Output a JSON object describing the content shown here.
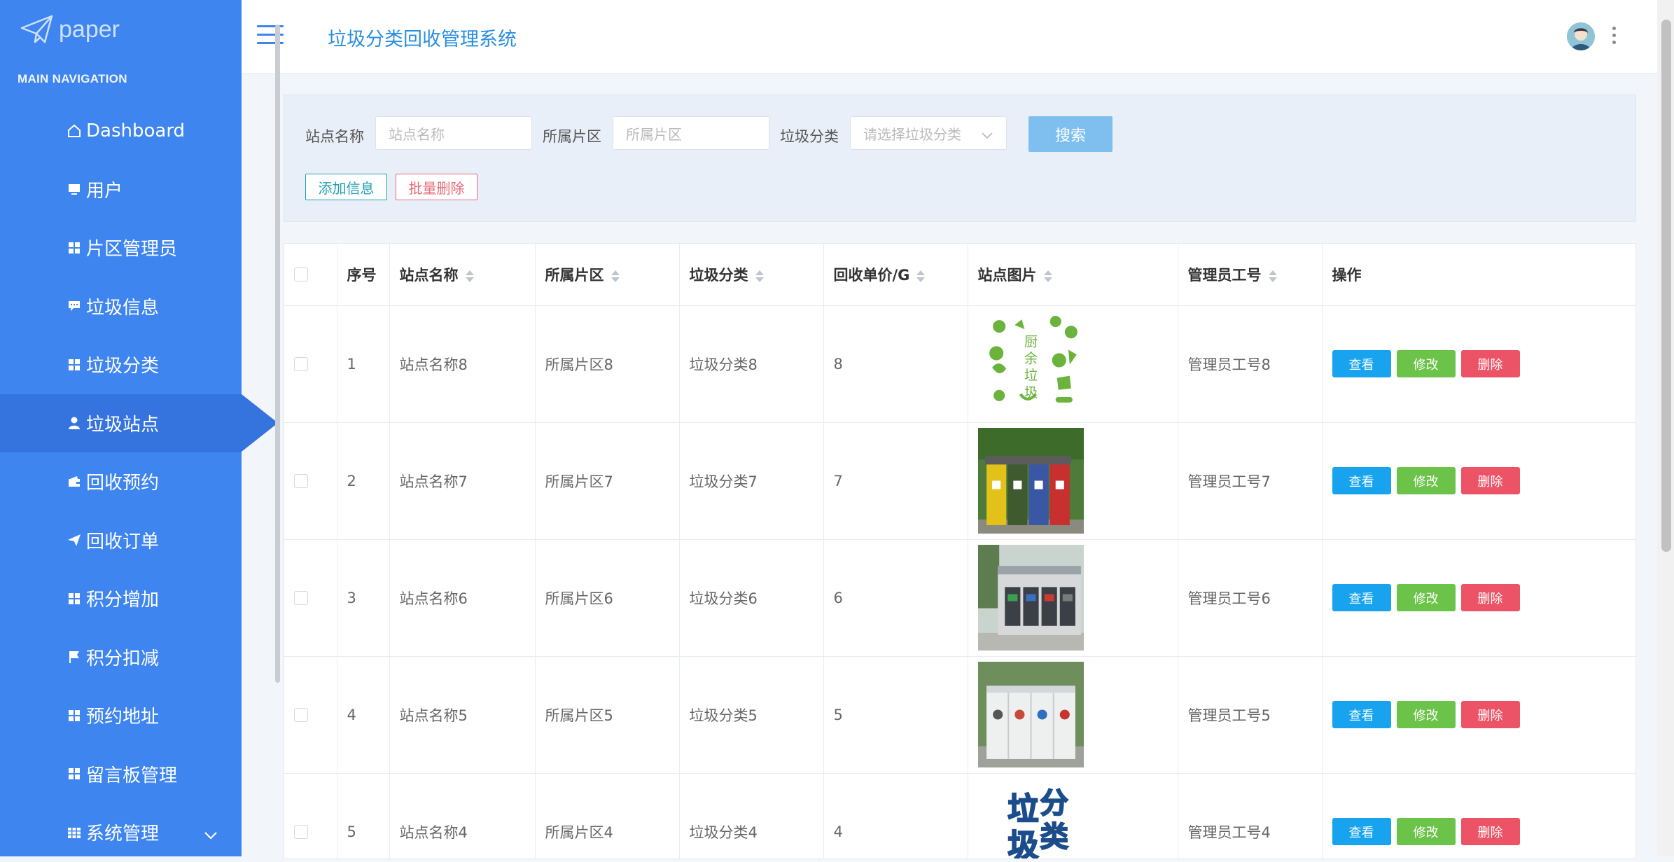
{
  "app": {
    "logo_text": "paper",
    "title": "垃圾分类回收管理系统"
  },
  "sidebar": {
    "section_label": "MAIN NAVIGATION",
    "items": [
      {
        "label": "Dashboard",
        "icon": "home-icon"
      },
      {
        "label": "用户",
        "icon": "monitor-icon"
      },
      {
        "label": "片区管理员",
        "icon": "grid-icon"
      },
      {
        "label": "垃圾信息",
        "icon": "comment-icon"
      },
      {
        "label": "垃圾分类",
        "icon": "grid-icon"
      },
      {
        "label": "垃圾站点",
        "icon": "user-icon",
        "active": true
      },
      {
        "label": "回收预约",
        "icon": "wallet-icon"
      },
      {
        "label": "回收订单",
        "icon": "send-icon"
      },
      {
        "label": "积分增加",
        "icon": "grid-icon"
      },
      {
        "label": "积分扣减",
        "icon": "flag-icon"
      },
      {
        "label": "预约地址",
        "icon": "grid-icon"
      },
      {
        "label": "留言板管理",
        "icon": "grid-icon"
      },
      {
        "label": "系统管理",
        "icon": "table-icon"
      }
    ]
  },
  "filters": {
    "site_name_label": "站点名称",
    "site_name_placeholder": "站点名称",
    "area_label": "所属片区",
    "area_placeholder": "所属片区",
    "category_label": "垃圾分类",
    "category_placeholder": "请选择垃圾分类",
    "search_button": "搜索",
    "add_button": "添加信息",
    "batch_delete_button": "批量删除"
  },
  "table": {
    "headers": [
      "序号",
      "站点名称",
      "所属片区",
      "垃圾分类",
      "回收单价/G",
      "站点图片",
      "管理员工号",
      "操作"
    ],
    "actions": {
      "view": "查看",
      "edit": "修改",
      "delete": "删除"
    },
    "rows": [
      {
        "index": "1",
        "site": "站点名称8",
        "area": "所属片区8",
        "category": "垃圾分类8",
        "price": "8",
        "image": "kitchen-waste-icon",
        "admin": "管理员工号8"
      },
      {
        "index": "2",
        "site": "站点名称7",
        "area": "所属片区7",
        "category": "垃圾分类7",
        "price": "7",
        "image": "colored-bins-photo",
        "admin": "管理员工号7"
      },
      {
        "index": "3",
        "site": "站点名称6",
        "area": "所属片区6",
        "category": "垃圾分类6",
        "price": "6",
        "image": "recycling-station-photo",
        "admin": "管理员工号6"
      },
      {
        "index": "4",
        "site": "站点名称5",
        "area": "所属片区5",
        "category": "垃圾分类5",
        "price": "5",
        "image": "white-bins-photo",
        "admin": "管理员工号5"
      },
      {
        "index": "5",
        "site": "站点名称4",
        "area": "所属片区4",
        "category": "垃圾分类4",
        "price": "4",
        "image": "classification-logo",
        "admin": "管理员工号4"
      }
    ]
  },
  "image_text": {
    "kitchen_waste": "厨余垃圾",
    "classification": "垃圾分类"
  },
  "colors": {
    "sidebar": "#3f85f0",
    "active": "#3573de",
    "title": "#2a8ee0",
    "view": "#17a3ee",
    "edit": "#6cc34a",
    "delete": "#ec5366"
  }
}
